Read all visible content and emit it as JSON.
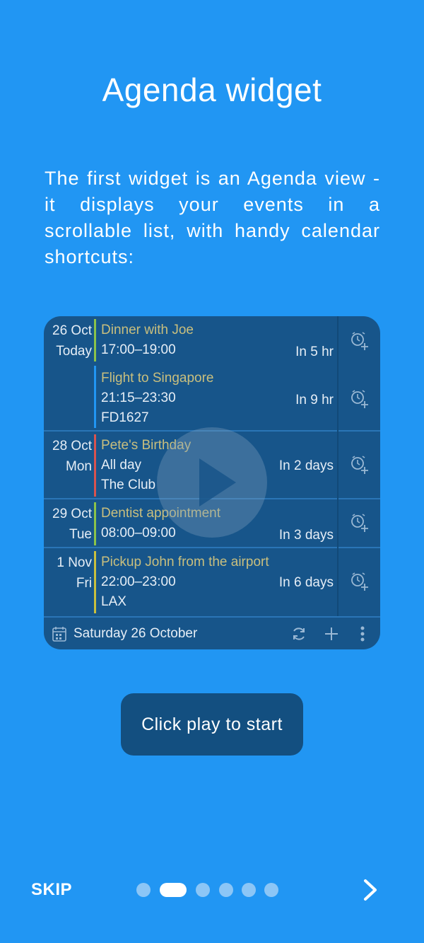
{
  "title": "Agenda widget",
  "description": "The first widget is an Agenda view - it displays your events in a scrollable list, with handy calendar shortcuts:",
  "widget": {
    "events": [
      {
        "date": "26 Oct",
        "day": "Today",
        "title": "Dinner with Joe",
        "time": "17:00–19:00",
        "extra": "",
        "relative": "In 5 hr",
        "color": "#8bc34a"
      },
      {
        "date": "",
        "day": "",
        "title": "Flight to Singapore",
        "time": "21:15–23:30",
        "extra": "FD1627",
        "relative": "In 9 hr",
        "color": "#2196F3"
      },
      {
        "date": "28 Oct",
        "day": "Mon",
        "title": "Pete's Birthday",
        "time": "All day",
        "extra": "The Club",
        "relative": "In 2 days",
        "color": "#d9534f"
      },
      {
        "date": "29 Oct",
        "day": "Tue",
        "title": "Dentist appointment",
        "time": "08:00–09:00",
        "extra": "",
        "relative": "In 3 days",
        "color": "#8bc34a"
      },
      {
        "date": "1 Nov",
        "day": "Fri",
        "title": "Pickup John from the airport",
        "time": "22:00–23:00",
        "extra": "LAX",
        "relative": "In 6 days",
        "color": "#c9bf3e"
      }
    ],
    "footer_date": "Saturday 26 October"
  },
  "cta_label": "Click play to start",
  "skip_label": "SKIP",
  "pager": {
    "count": 6,
    "active": 1
  }
}
